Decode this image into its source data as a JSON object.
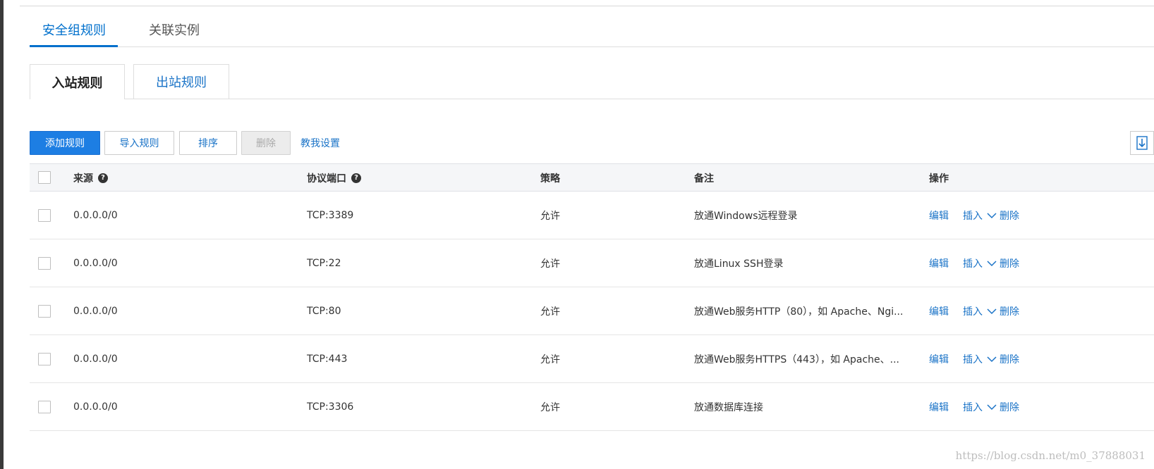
{
  "tabs": [
    {
      "label": "安全组规则",
      "active": true
    },
    {
      "label": "关联实例",
      "active": false
    }
  ],
  "subtabs": [
    {
      "label": "入站规则",
      "active": true
    },
    {
      "label": "出站规则",
      "active": false
    }
  ],
  "toolbar": {
    "add_label": "添加规则",
    "import_label": "导入规则",
    "sort_label": "排序",
    "delete_label": "删除",
    "teach_label": "教我设置",
    "export_icon": "download-icon"
  },
  "table": {
    "headers": {
      "source": "来源",
      "port": "协议端口",
      "policy": "策略",
      "note": "备注",
      "ops": "操作"
    },
    "help_icon": "?",
    "ops_labels": {
      "edit": "编辑",
      "insert": "插入",
      "delete": "删除"
    },
    "rows": [
      {
        "source": "0.0.0.0/0",
        "port": "TCP:3389",
        "policy": "允许",
        "note": "放通Windows远程登录"
      },
      {
        "source": "0.0.0.0/0",
        "port": "TCP:22",
        "policy": "允许",
        "note": "放通Linux SSH登录"
      },
      {
        "source": "0.0.0.0/0",
        "port": "TCP:80",
        "policy": "允许",
        "note": "放通Web服务HTTP（80），如 Apache、Ngi..."
      },
      {
        "source": "0.0.0.0/0",
        "port": "TCP:443",
        "policy": "允许",
        "note": "放通Web服务HTTPS（443），如 Apache、..."
      },
      {
        "source": "0.0.0.0/0",
        "port": "TCP:3306",
        "policy": "允许",
        "note": "放通数据库连接"
      }
    ]
  },
  "watermark": "https://blog.csdn.net/m0_37888031",
  "colors": {
    "accent": "#1d7ee3",
    "link": "#1a73c7",
    "disabled_bg": "#ececec"
  }
}
